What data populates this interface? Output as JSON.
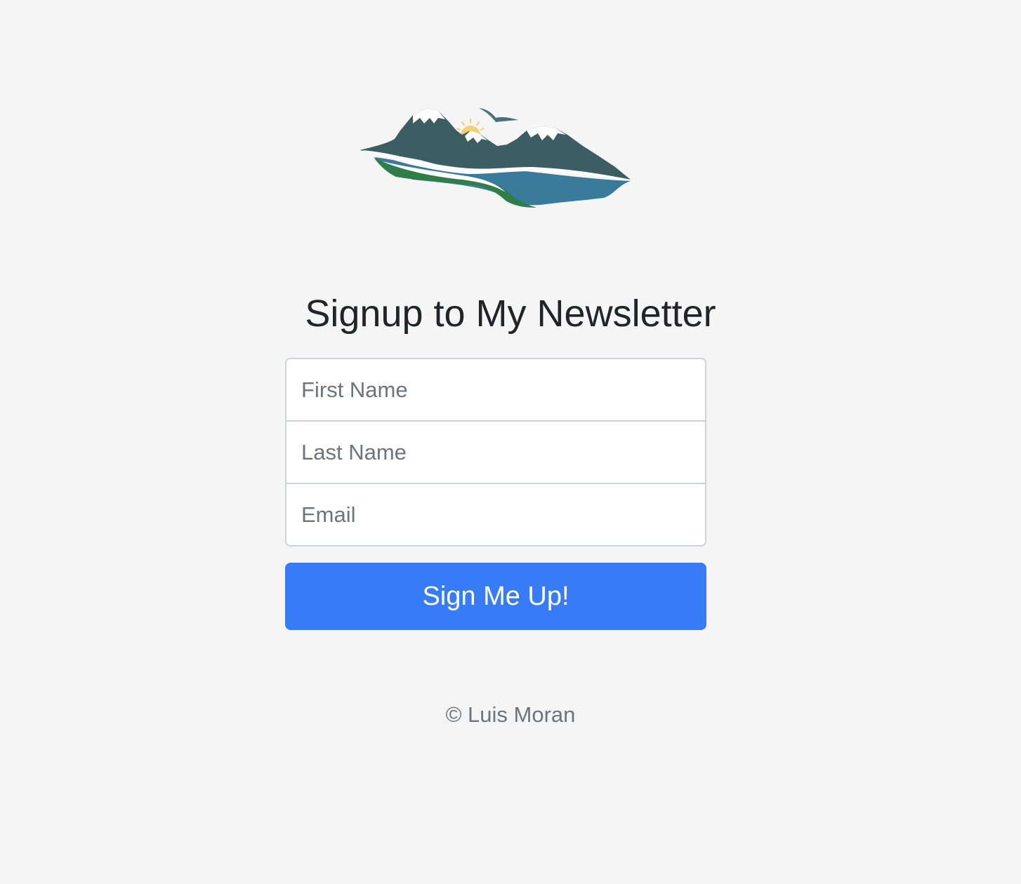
{
  "logo": {
    "icon": "mountains-lake-logo",
    "colors": {
      "mountain": "#3d5d64",
      "snow": "#ffffff",
      "water": "#3a7b9c",
      "grass": "#2f7d49",
      "sun": "#f4d06f",
      "bird": "#4a6f7d"
    }
  },
  "form": {
    "title": "Signup to My Newsletter",
    "first_name_placeholder": "First Name",
    "last_name_placeholder": "Last Name",
    "email_placeholder": "Email",
    "submit_label": "Sign Me Up!"
  },
  "footer": {
    "text": "© Luis Moran"
  },
  "colors": {
    "background": "#f5f5f5",
    "button": "#377bf6",
    "title": "#212529",
    "muted": "#6c757d"
  }
}
